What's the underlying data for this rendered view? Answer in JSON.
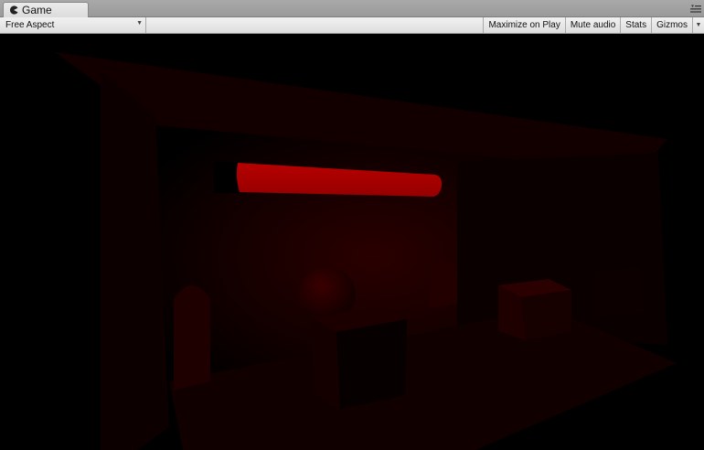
{
  "window": {
    "tab_title": "Game",
    "tab_icon": "pacman-icon"
  },
  "toolbar": {
    "aspect_label": "Free Aspect",
    "maximize_label": "Maximize on Play",
    "mute_label": "Mute audio",
    "stats_label": "Stats",
    "gizmos_label": "Gizmos"
  },
  "scene": {
    "description_colors": {
      "background": "#000000",
      "wall": "#1a0000",
      "health_bar_fill": "#a60000",
      "health_bar_empty": "#000000"
    },
    "health_bar": {
      "fill_fraction": 0.9
    }
  }
}
